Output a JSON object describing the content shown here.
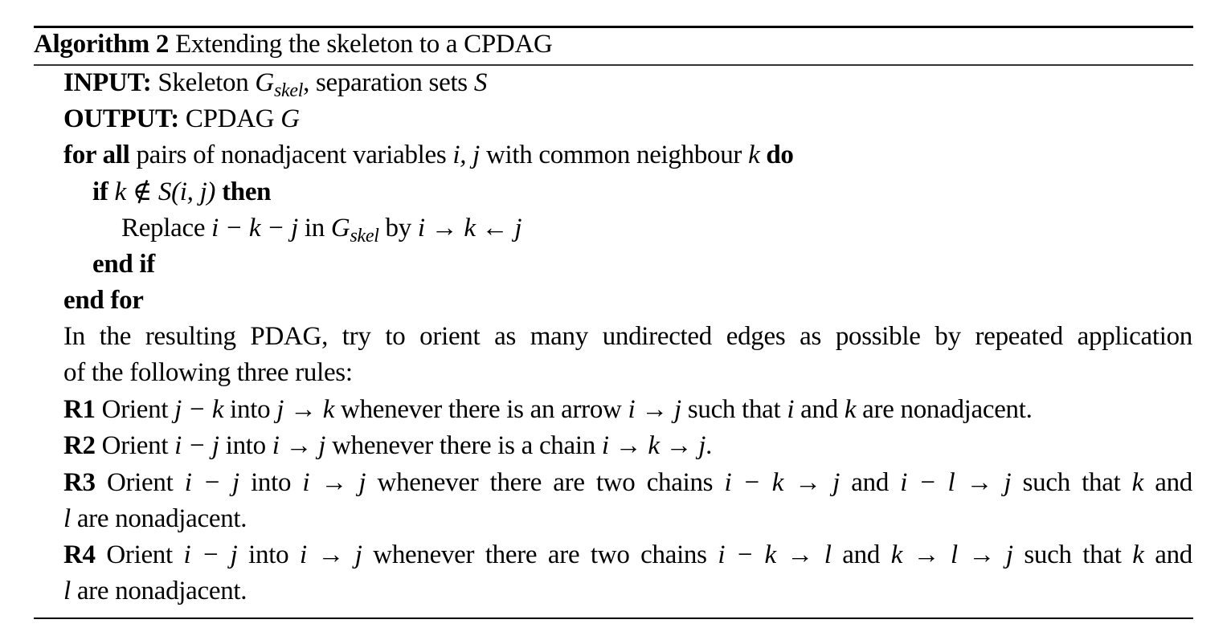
{
  "algorithm": {
    "label": "Algorithm 2",
    "title": "Extending the skeleton to a CPDAG",
    "input_keyword": "INPUT:",
    "input_text_a": "Skeleton ",
    "input_G": "G",
    "input_sub": "skel",
    "input_text_b": ", separation sets ",
    "input_S": "S",
    "output_keyword": "OUTPUT:",
    "output_text": "CPDAG ",
    "output_G": "G",
    "for_keyword": "for all",
    "for_text_a": " pairs of nonadjacent variables ",
    "for_vars": "i, j",
    "for_text_b": " with common neighbour ",
    "for_k": "k",
    "do_keyword": "do",
    "if_keyword": "if",
    "if_condition_k": "k",
    "if_condition_op": " ∉ ",
    "if_condition_S": "S",
    "if_condition_args": "(i, j)",
    "then_keyword": "then",
    "replace_text": "Replace ",
    "replace_pattern": "i − k − j",
    "replace_in": " in ",
    "replace_G": "G",
    "replace_sub": "skel",
    "replace_by": " by ",
    "replace_result": "i → k ← j",
    "endif_keyword": "end if",
    "endfor_keyword": "end for",
    "paragraph_line1": "In the resulting PDAG, try to orient as many undirected edges as possible by repeated application",
    "paragraph_line2": "of the following three rules:",
    "rules": [
      {
        "label": "R1",
        "parts": [
          " Orient ",
          "j − k",
          " into ",
          "j → k",
          " whenever there is an arrow ",
          "i → j",
          " such that ",
          "i",
          " and ",
          "k",
          " are nonadjacent."
        ]
      },
      {
        "label": "R2",
        "parts": [
          " Orient ",
          "i − j",
          " into ",
          "i → j",
          " whenever there is a chain ",
          "i → k → j",
          "."
        ]
      },
      {
        "label": "R3",
        "parts": [
          " Orient ",
          "i − j",
          " into ",
          "i → j",
          " whenever there are two chains ",
          "i − k → j",
          " and ",
          "i − l → j",
          " such that ",
          "k",
          " and"
        ],
        "cont": [
          "l",
          " are nonadjacent."
        ]
      },
      {
        "label": "R4",
        "parts": [
          " Orient ",
          "i − j",
          " into ",
          "i → j",
          " whenever there are two chains ",
          "i − k → l",
          " and ",
          "k → l → j",
          " such that ",
          "k",
          " and"
        ],
        "cont": [
          "l",
          " are nonadjacent."
        ]
      }
    ]
  }
}
